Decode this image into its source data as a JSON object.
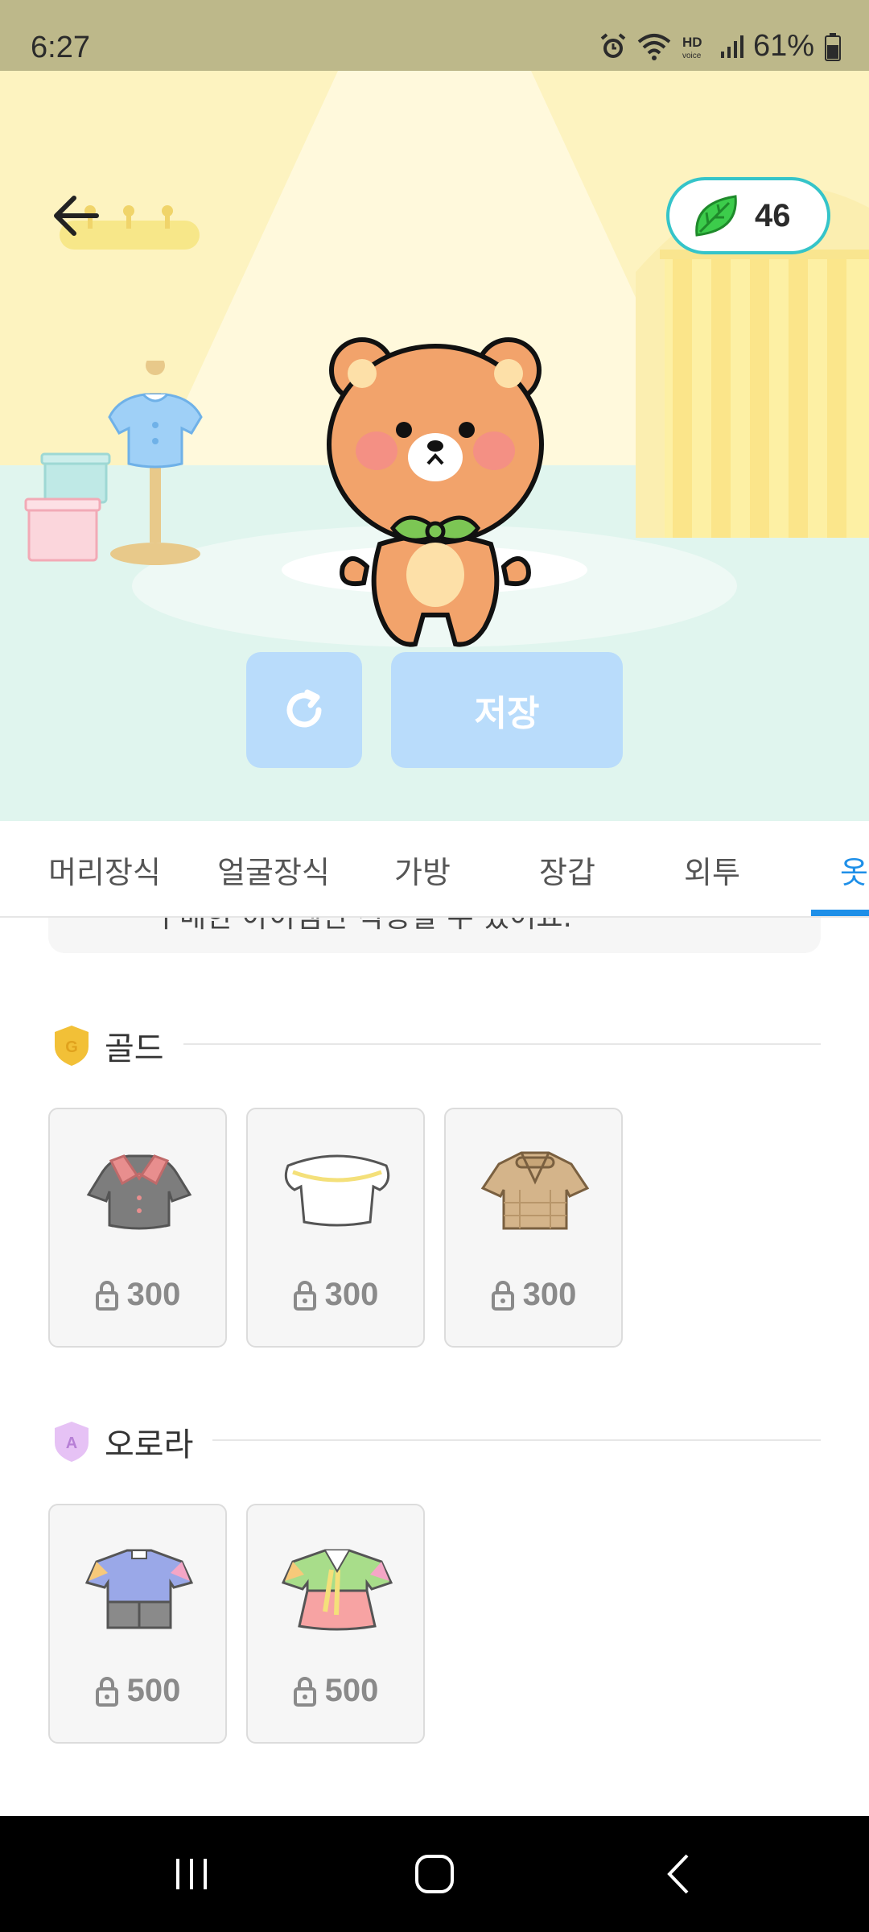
{
  "status_bar": {
    "time": "6:27",
    "battery": "61%"
  },
  "header": {
    "leaf_count": "46"
  },
  "actions": {
    "save_label": "저장"
  },
  "tabs": [
    {
      "label": "머리장식"
    },
    {
      "label": "얼굴장식"
    },
    {
      "label": "가방"
    },
    {
      "label": "장갑"
    },
    {
      "label": "외투"
    },
    {
      "label": "옷"
    }
  ],
  "notice": {
    "text": "구매한 아이템만 착용할 수 있어요."
  },
  "sections": [
    {
      "title": "골드",
      "badge": "G",
      "items": [
        {
          "price": "300",
          "art": "gray-collar-shirt"
        },
        {
          "price": "300",
          "art": "white-frill-top"
        },
        {
          "price": "300",
          "art": "tan-check-jacket"
        }
      ]
    },
    {
      "title": "오로라",
      "badge": "A",
      "items": [
        {
          "price": "500",
          "art": "blue-overall-outfit"
        },
        {
          "price": "500",
          "art": "hanbok-pink-green"
        }
      ]
    }
  ],
  "colors": {
    "accent": "#1e8fe8",
    "button": "#b9dcfb",
    "room_wall": "#fdf3c0",
    "room_floor": "#e0f5ee",
    "badge_border": "#35c4c9",
    "gold": "#f2c037",
    "aurora": "#d9a6f0"
  }
}
